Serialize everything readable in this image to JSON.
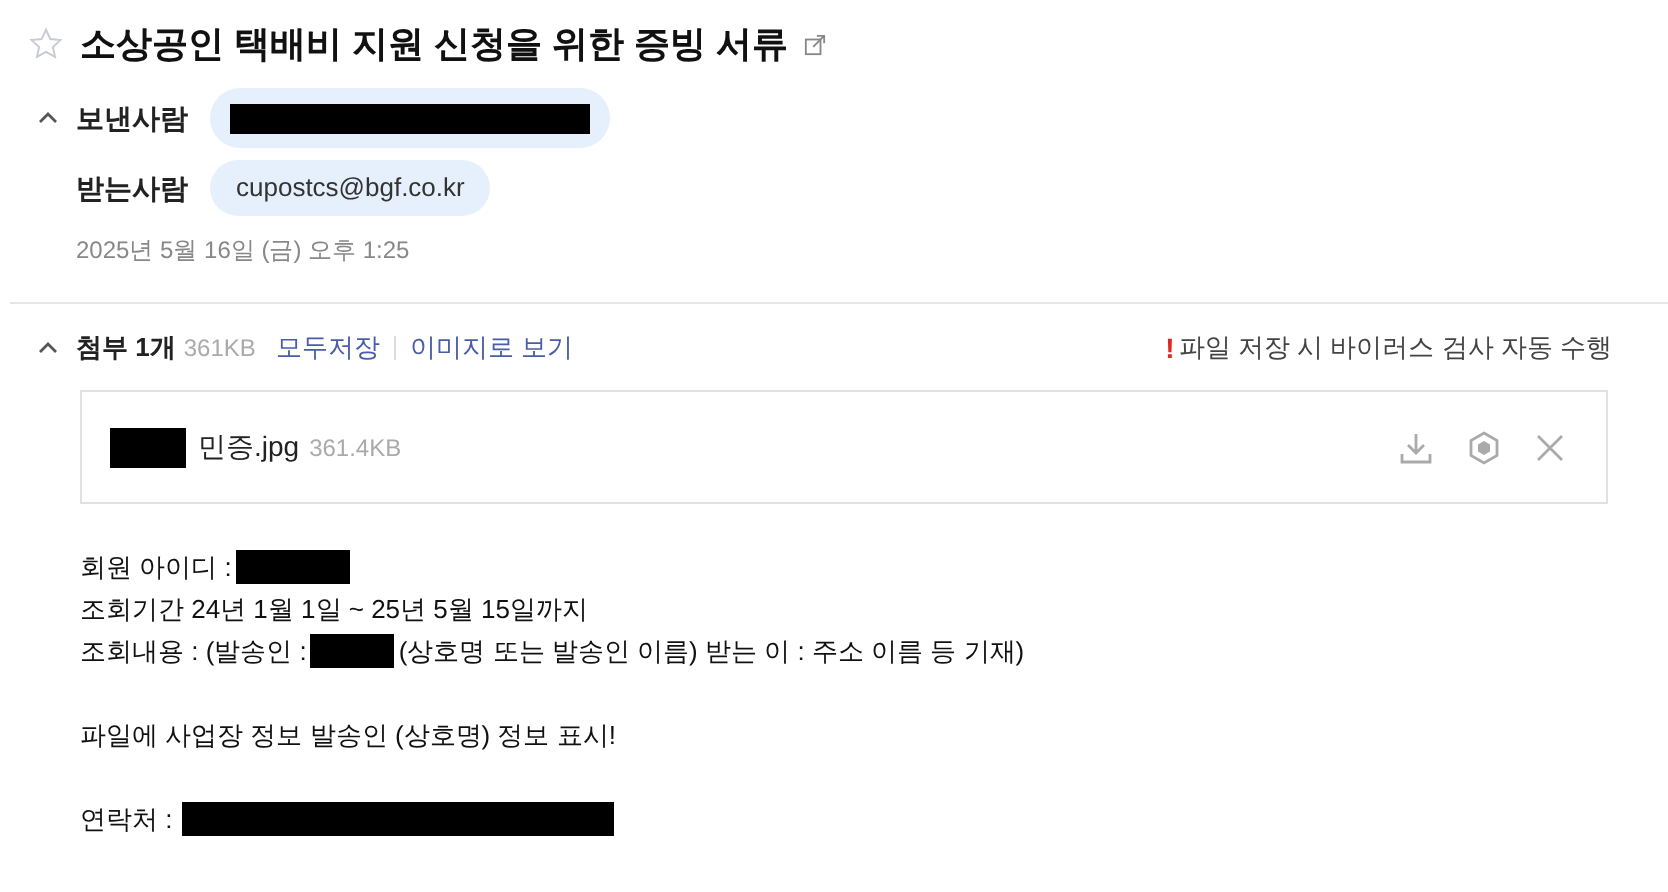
{
  "subject": {
    "title": "소상공인 택배비 지원 신청을 위한 증빙 서류",
    "starred": false
  },
  "header": {
    "expanded": true,
    "sender": {
      "label": "보낸사람",
      "redacted": true
    },
    "recipient": {
      "label": "받는사람",
      "address": "cupostcs@bgf.co.kr"
    },
    "date": "2025년 5월 16일 (금) 오후 1:25"
  },
  "attachments": {
    "expanded": true,
    "title": "첨부 1개",
    "total_size": "361KB",
    "actions": [
      "모두저장",
      "이미지로 보기"
    ],
    "notice_mark": "!",
    "notice": "파일 저장 시 바이러스 검사 자동 수행",
    "files": [
      {
        "name": "민증.jpg",
        "size": "361.4KB",
        "thumbnail_redacted": true
      }
    ]
  },
  "body": [
    [
      [
        {
          "kind": "text",
          "text": "회원 아이디 :"
        },
        {
          "kind": "redacted_short"
        }
      ],
      [
        {
          "kind": "text",
          "text": "조회기간 24년 1월 1일 ~ 25년 5월 15일까지"
        }
      ],
      [
        {
          "kind": "text",
          "text": "조회내용 : (발송인 :"
        },
        {
          "kind": "redacted_short"
        },
        {
          "kind": "text",
          "text": "(상호명 또는 발송인 이름) 받는 이 : 주소 이름 등 기재)"
        }
      ]
    ],
    [
      [
        {
          "kind": "text",
          "text": "파일에 사업장 정보 발송인 (상호명) 정보 표시!"
        }
      ]
    ],
    [
      [
        {
          "kind": "text",
          "text": "연락처 :"
        },
        {
          "kind": "redacted_long"
        }
      ]
    ]
  ]
}
